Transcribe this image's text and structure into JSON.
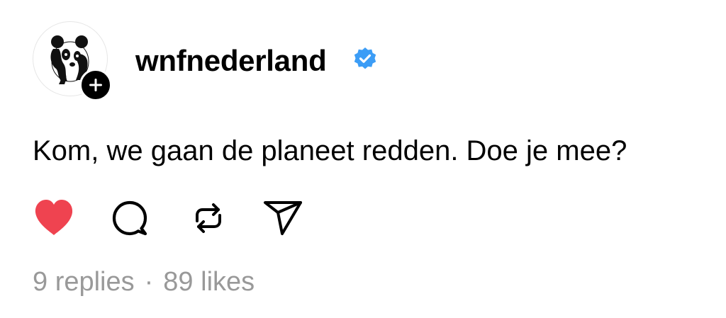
{
  "post": {
    "author": {
      "username": "wnfnederland",
      "verified": true,
      "avatar_icon": "panda-logo-icon",
      "follow_icon": "plus-icon"
    },
    "text": "Kom, we gaan de planeet redden. Doe je mee?",
    "liked": true,
    "stats": {
      "replies": "9 replies",
      "separator": "·",
      "likes": "89 likes"
    }
  },
  "actions": [
    {
      "name": "like",
      "icon": "heart-icon"
    },
    {
      "name": "reply",
      "icon": "comment-icon"
    },
    {
      "name": "repost",
      "icon": "repost-icon"
    },
    {
      "name": "share",
      "icon": "send-icon"
    }
  ],
  "colors": {
    "like": "#ef4350",
    "verified": "#3c9df6",
    "muted": "#999999",
    "text": "#000000"
  }
}
